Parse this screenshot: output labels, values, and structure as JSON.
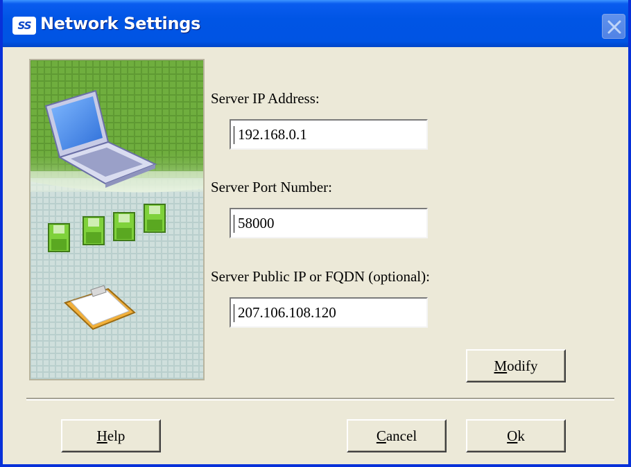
{
  "window": {
    "title": "Network Settings",
    "app_icon_text": "SS"
  },
  "fields": [
    {
      "label": "Server IP Address:",
      "value": "192.168.0.1"
    },
    {
      "label": "Server Port Number:",
      "value": "58000"
    },
    {
      "label": "Server Public IP or FQDN (optional):",
      "value": "207.106.108.120"
    }
  ],
  "buttons": {
    "modify": {
      "accel": "M",
      "rest": "odify"
    },
    "help": {
      "accel": "H",
      "rest": "elp"
    },
    "cancel": {
      "accel": "C",
      "rest": "ancel"
    },
    "ok": {
      "accel": "O",
      "rest": "k"
    }
  },
  "colors": {
    "titlebar": "#0054e3",
    "dialog_bg": "#ece9d8",
    "picture_green": "#6aa83a",
    "floppy_green": "#7fd13b"
  },
  "icons": [
    "app-icon",
    "close-icon",
    "laptop-icon",
    "floppy-icon",
    "clipboard-icon"
  ]
}
